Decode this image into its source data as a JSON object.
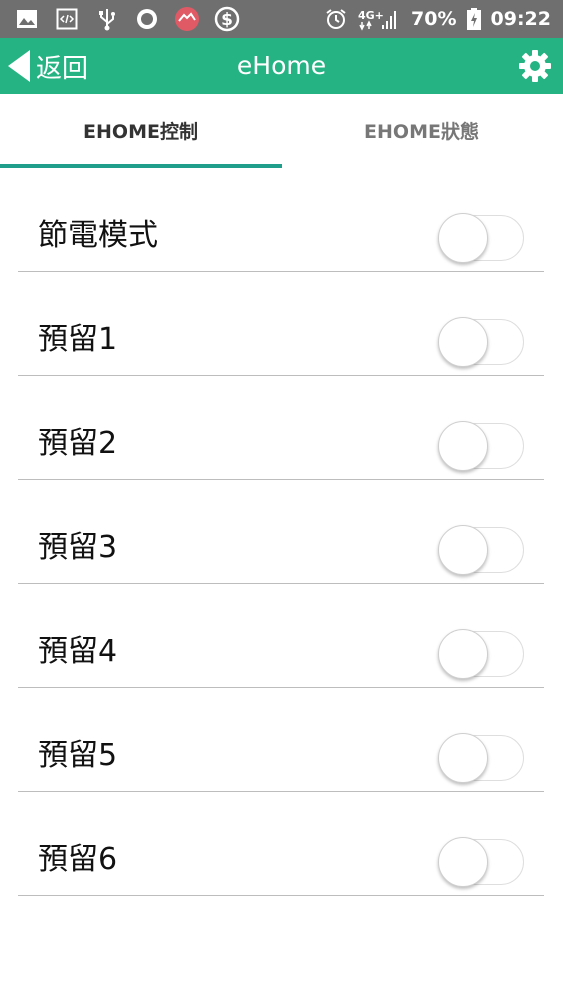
{
  "status_bar": {
    "battery": "70%",
    "time": "09:22",
    "left_icons": [
      "image-icon",
      "code-icon",
      "usb-icon",
      "record-icon",
      "cloud-app-icon",
      "dollar-icon"
    ],
    "right_icons": [
      "alarm-icon",
      "4g-signal-icon",
      "battery-icon"
    ]
  },
  "app_bar": {
    "back_label": "返回",
    "title": "eHome",
    "background": "#26b384"
  },
  "tabs": [
    {
      "label": "EHOME控制",
      "active": true
    },
    {
      "label": "EHOME狀態",
      "active": false
    }
  ],
  "accent": "#1f9e8c",
  "rows": [
    {
      "label": "節電模式",
      "on": false
    },
    {
      "label": "預留1",
      "on": false
    },
    {
      "label": "預留2",
      "on": false
    },
    {
      "label": "預留3",
      "on": false
    },
    {
      "label": "預留4",
      "on": false
    },
    {
      "label": "預留5",
      "on": false
    },
    {
      "label": "預留6",
      "on": false
    }
  ]
}
